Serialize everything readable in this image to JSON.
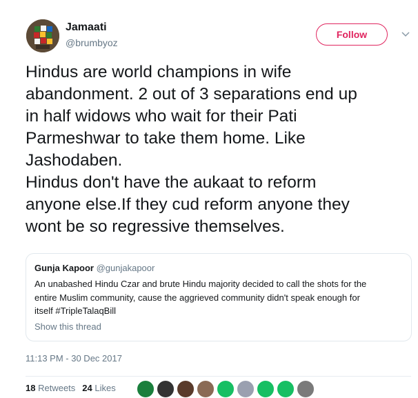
{
  "user": {
    "name": "Jamaati",
    "handle": "@brumbyoz"
  },
  "follow_label": "Follow",
  "tweet_lines": [
    "Hindus are world champions in wife",
    "abandonment. 2 out of 3 separations end up",
    "in half widows who wait for their Pati",
    "Parmeshwar to take them home. Like",
    "Jashodaben.",
    "Hindus don't have the aukaat to reform",
    "anyone else.If they cud reform anyone they",
    "wont be so regressive themselves."
  ],
  "quoted": {
    "name": "Gunja Kapoor",
    "handle": "@gunjakapoor",
    "text_lines": [
      "An unabashed Hindu Czar and brute Hindu majority decided to call the shots for the",
      "entire Muslim community, cause the aggrieved community didn't speak enough for",
      "itself #TripleTalaqBill"
    ],
    "show_thread": "Show this thread"
  },
  "timestamp": "11:13 PM - 30 Dec 2017",
  "stats": {
    "retweets_count": "18",
    "retweets_label": "Retweets",
    "likes_count": "24",
    "likes_label": "Likes"
  },
  "liker_colors": [
    "#1a7f3c",
    "#333333",
    "#5a3b2b",
    "#8a6a55",
    "#17bf63",
    "#9aa0b0",
    "#17bf63",
    "#17bf63",
    "#7a7a7a"
  ],
  "colors": {
    "follow_accent": "#e0245e",
    "secondary_text": "#657786"
  },
  "icons": {
    "chevron": "chevron-down-icon"
  }
}
